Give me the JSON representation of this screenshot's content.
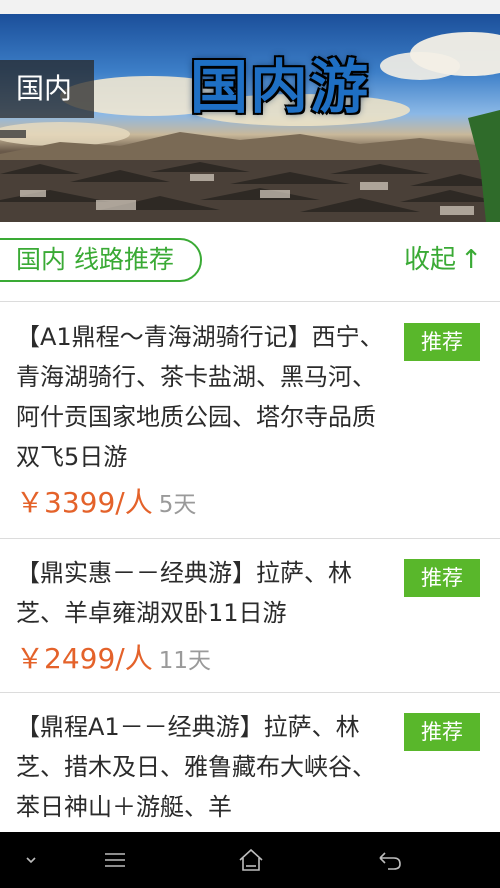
{
  "banner": {
    "title": "国内游",
    "tag": "国内"
  },
  "section": {
    "title": "国内 线路推荐",
    "collapse_label": "收起",
    "collapse_icon": "arrow-up-icon",
    "accent_color": "#3aaa35"
  },
  "routes": [
    {
      "title": "【A1鼎程～青海湖骑行记】西宁、青海湖骑行、茶卡盐湖、黑马河、阿什贡国家地质公园、塔尔寺品质双飞5日游",
      "price": "￥3399/人",
      "days": "5天",
      "badge": "推荐"
    },
    {
      "title": "【鼎实惠－－经典游】拉萨、林芝、羊卓雍湖双卧11日游",
      "price": "￥2499/人",
      "days": "11天",
      "badge": "推荐"
    },
    {
      "title": "【鼎程A1－－经典游】拉萨、林芝、措木及日、雅鲁藏布大峡谷、苯日神山＋游艇、羊",
      "price": "",
      "days": "",
      "badge": "推荐"
    }
  ],
  "colors": {
    "price": "#e4622a",
    "badge": "#59b72b"
  },
  "navbar": {
    "icons": [
      "chevron-down-icon",
      "menu-icon",
      "home-icon",
      "back-icon"
    ]
  }
}
